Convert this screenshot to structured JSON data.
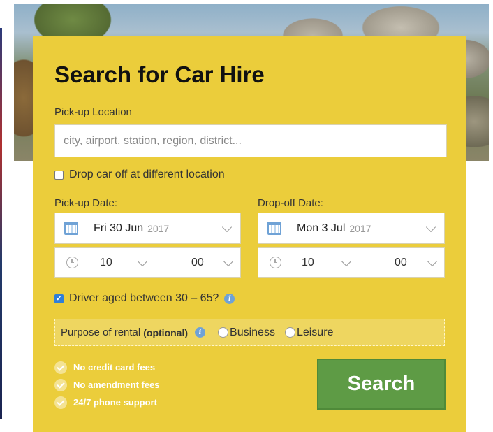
{
  "form": {
    "title": "Search for Car Hire",
    "pickup_location_label": "Pick-up Location",
    "pickup_location_placeholder": "city, airport, station, region, district...",
    "pickup_location_value": "",
    "drop_off_different_label": "Drop car off at different location",
    "drop_off_different_checked": false,
    "pickup_date_label": "Pick-up Date:",
    "dropoff_date_label": "Drop-off Date:",
    "pickup_date": {
      "day": "Fri 30 Jun",
      "year": "2017",
      "hour": "10",
      "minute": "00"
    },
    "dropoff_date": {
      "day": "Mon 3 Jul",
      "year": "2017",
      "hour": "10",
      "minute": "00"
    },
    "driver_age_label": "Driver aged between 30 – 65?",
    "driver_age_checked": true,
    "purpose_label": "Purpose of rental",
    "purpose_optional": "(optional)",
    "purpose_options": [
      "Business",
      "Leisure"
    ],
    "benefits": [
      "No credit card fees",
      "No amendment fees",
      "24/7 phone support"
    ],
    "search_label": "Search"
  },
  "colors": {
    "panel": "#ebcd3b",
    "search_button": "#5e9b45",
    "checkbox_checked": "#2f7fd8",
    "info_icon": "#6fa2d6"
  },
  "icons": {
    "calendar": "calendar-icon",
    "clock": "clock-icon",
    "chevron": "chevron-down-icon",
    "info": "info-icon",
    "check": "check-icon"
  }
}
